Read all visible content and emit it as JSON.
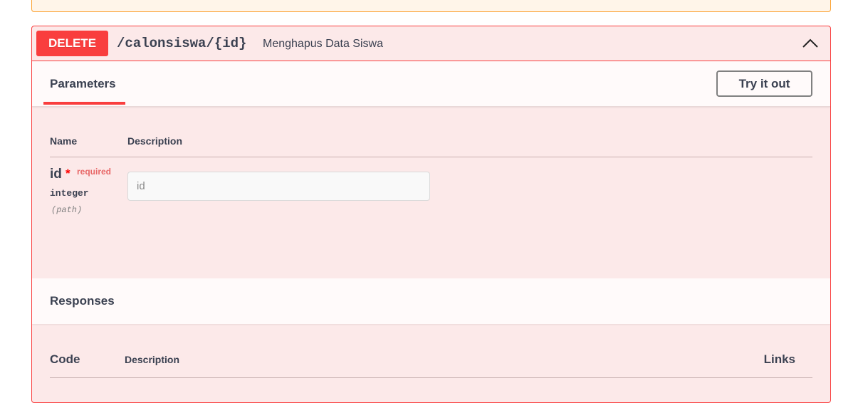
{
  "operation": {
    "method": "DELETE",
    "path": "/calonsiswa/{id}",
    "summary": "Menghapus Data Siswa",
    "method_color": "#f93e3e"
  },
  "parameters": {
    "tab_label": "Parameters",
    "try_button": "Try it out",
    "columns": {
      "name": "Name",
      "description": "Description"
    },
    "items": [
      {
        "name": "id",
        "required_mark": "*",
        "required_label": "required",
        "type": "integer",
        "in": "(path)",
        "placeholder": "id"
      }
    ]
  },
  "responses": {
    "title": "Responses",
    "columns": {
      "code": "Code",
      "description": "Description",
      "links": "Links"
    }
  },
  "icons": {
    "collapse": "chevron-up-icon"
  }
}
